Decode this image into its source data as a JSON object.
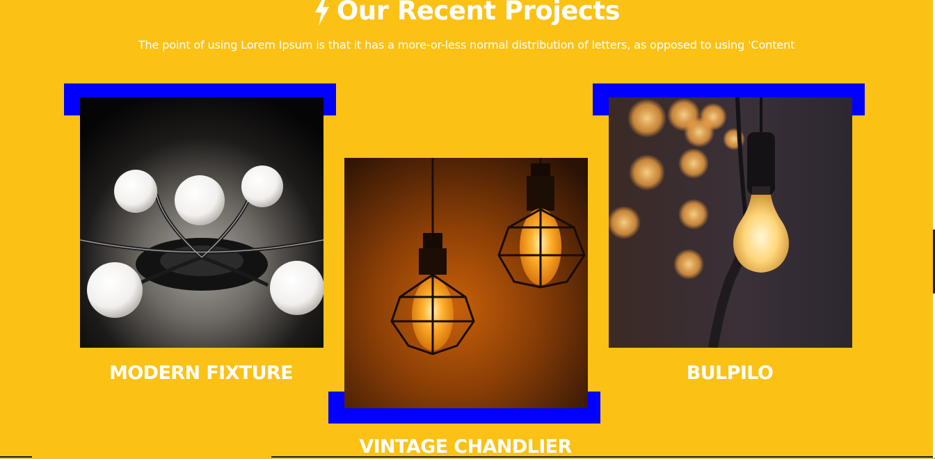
{
  "section": {
    "title": "Our Recent Projects",
    "subtitle": "The point of using Lorem Ipsum is that it has a more-or-less normal distribution of letters, as opposed to using 'Content"
  },
  "projects": [
    {
      "title": "MODERN FIXTURE"
    },
    {
      "title": "VINTAGE CHANDLIER"
    },
    {
      "title": "BULPILO"
    }
  ],
  "colors": {
    "background": "#fbc115",
    "accent": "#0000ff",
    "text": "#ffffff"
  },
  "icons": {
    "title_icon": "lightning-bolt-icon"
  }
}
